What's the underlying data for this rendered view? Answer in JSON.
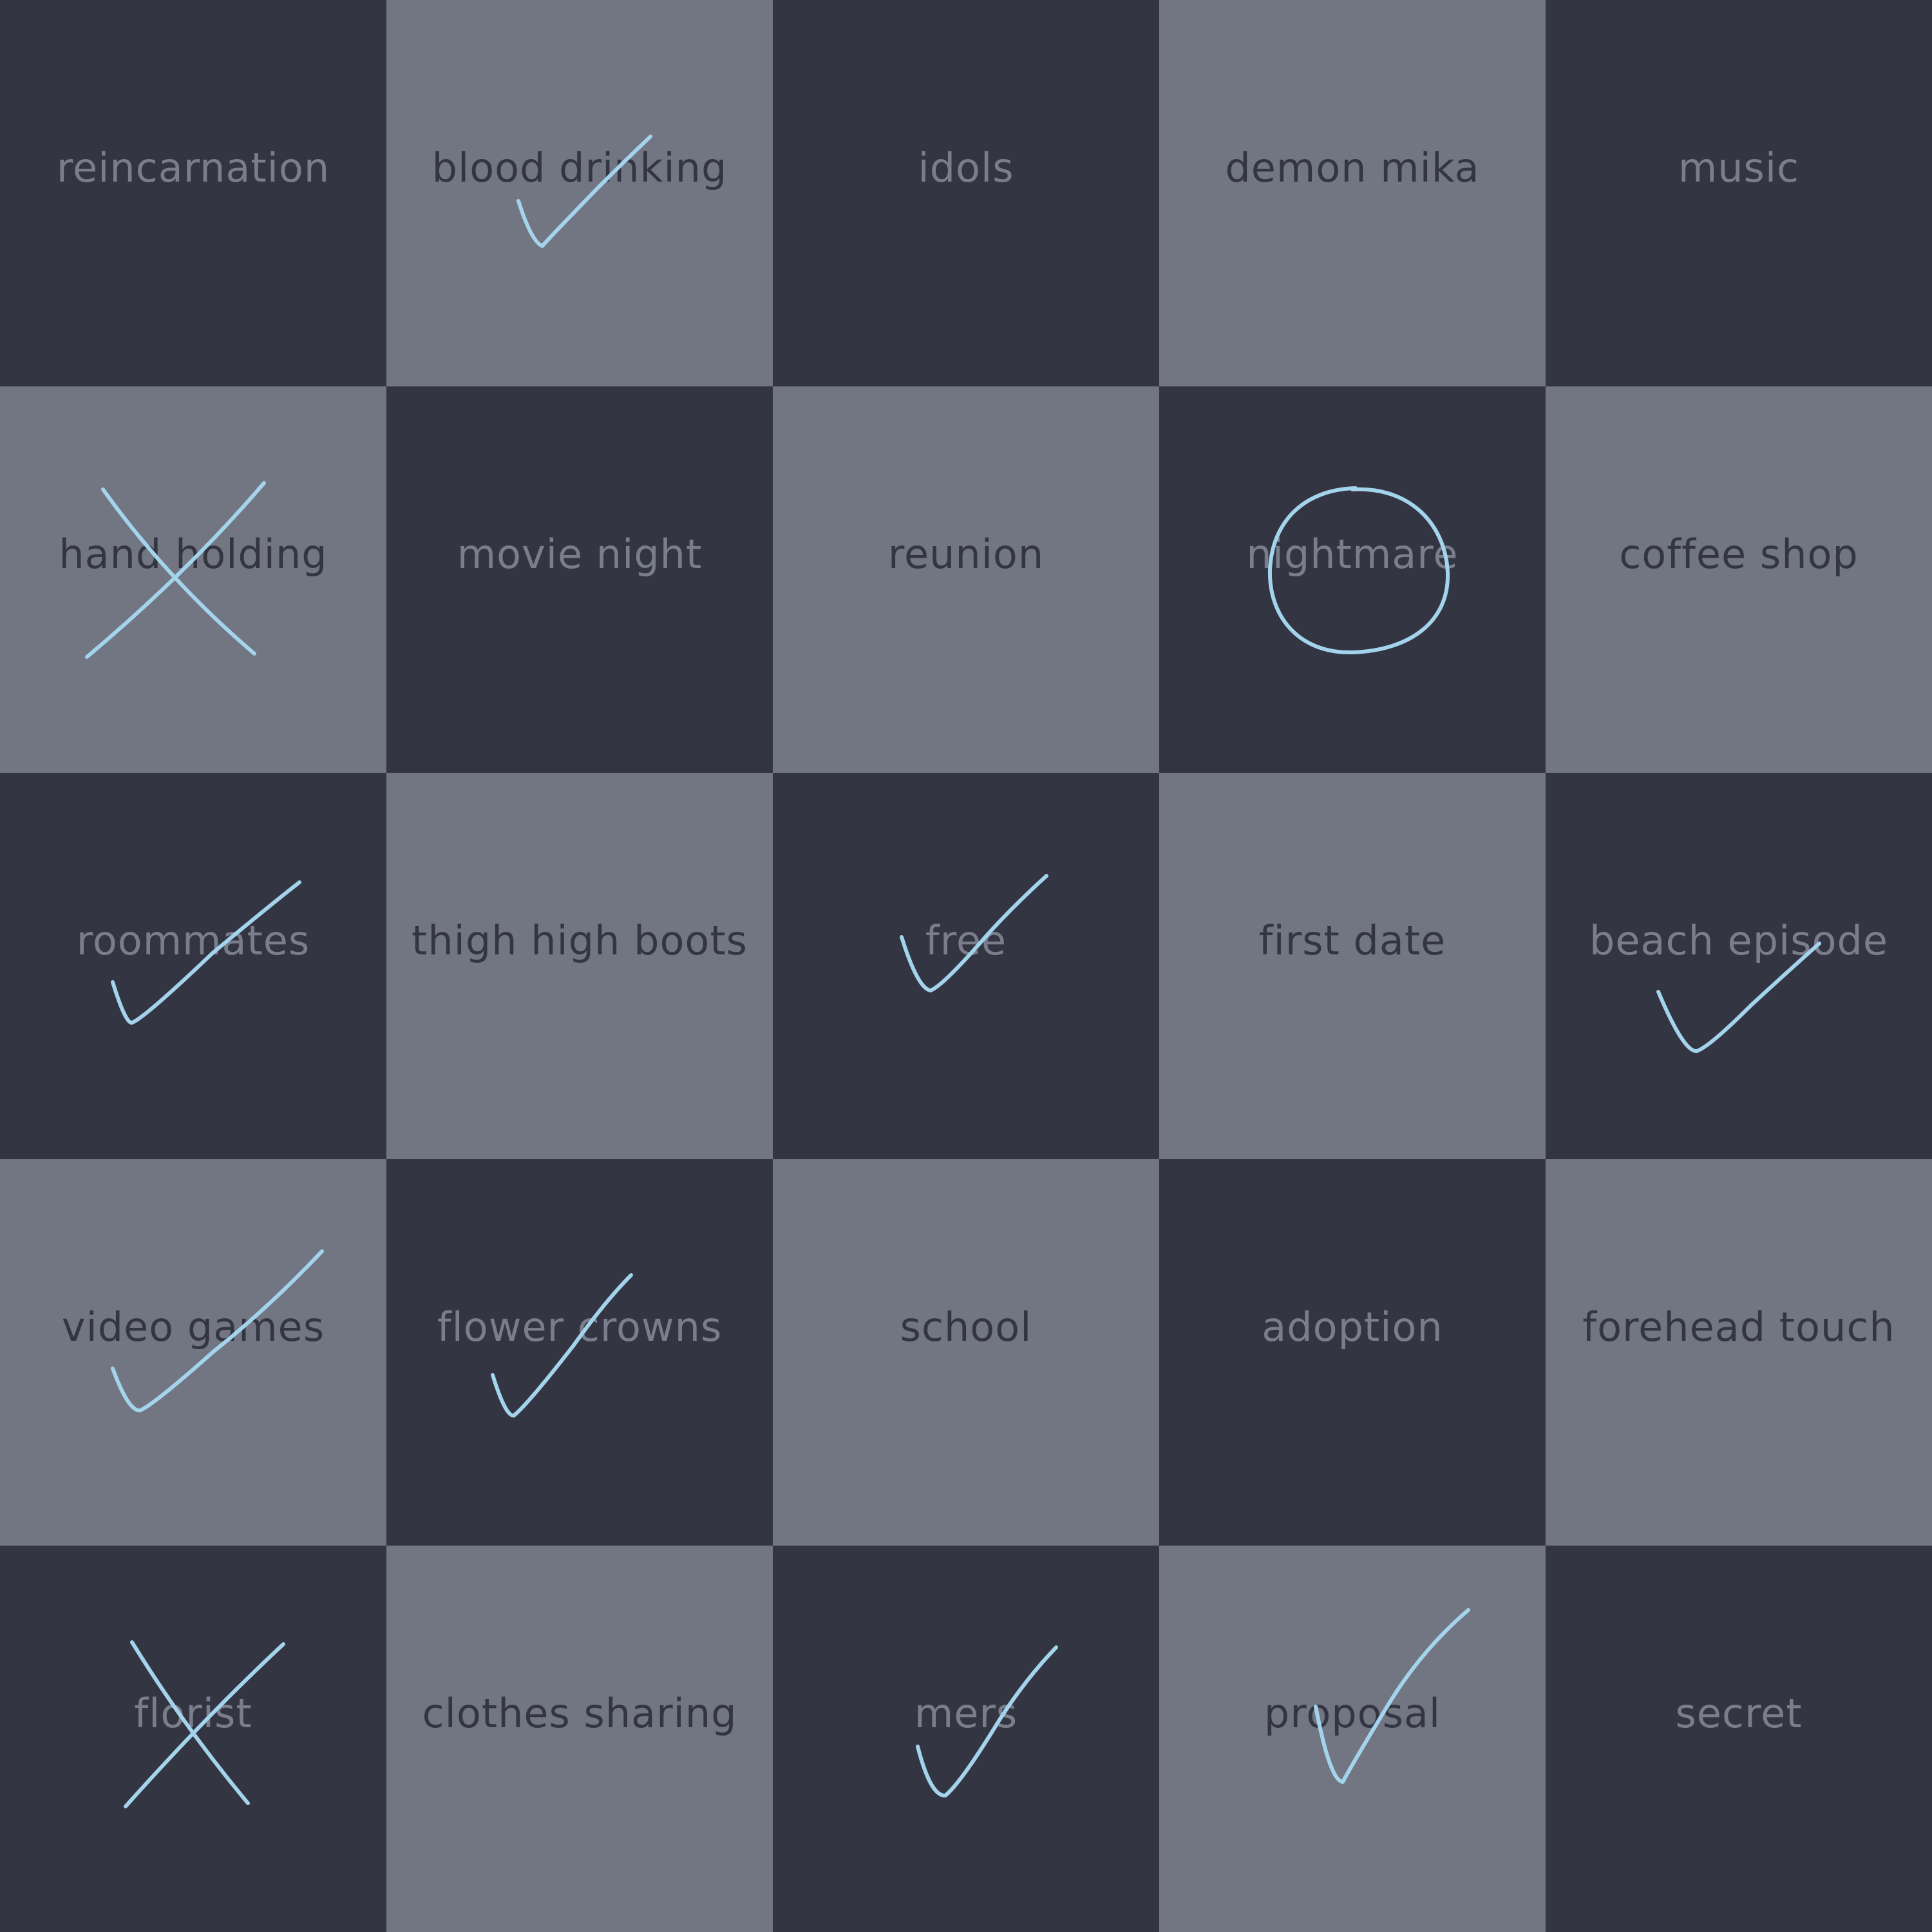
{
  "colors": {
    "dark_cell": "#333542",
    "light_cell": "#727683",
    "mark": "#a3d4ec"
  },
  "board": {
    "rows": 5,
    "cols": 5,
    "cells": [
      {
        "label": "reincarnation",
        "mark": "none"
      },
      {
        "label": "blood drinking",
        "mark": "check"
      },
      {
        "label": "idols",
        "mark": "none"
      },
      {
        "label": "demon mika",
        "mark": "none"
      },
      {
        "label": "music",
        "mark": "none"
      },
      {
        "label": "hand holding",
        "mark": "cross"
      },
      {
        "label": "movie night",
        "mark": "none"
      },
      {
        "label": "reunion",
        "mark": "none"
      },
      {
        "label": "nightmare",
        "mark": "circle"
      },
      {
        "label": "coffee shop",
        "mark": "none"
      },
      {
        "label": "roommates",
        "mark": "check"
      },
      {
        "label": "thigh high boots",
        "mark": "none"
      },
      {
        "label": "free",
        "mark": "check"
      },
      {
        "label": "first date",
        "mark": "none"
      },
      {
        "label": "beach episode",
        "mark": "check"
      },
      {
        "label": "video games",
        "mark": "check"
      },
      {
        "label": "flower crowns",
        "mark": "check"
      },
      {
        "label": "school",
        "mark": "none"
      },
      {
        "label": "adoption",
        "mark": "none"
      },
      {
        "label": "forehead touch",
        "mark": "none"
      },
      {
        "label": "florist",
        "mark": "cross"
      },
      {
        "label": "clothes sharing",
        "mark": "none"
      },
      {
        "label": "mers",
        "mark": "check"
      },
      {
        "label": "proposal",
        "mark": "check"
      },
      {
        "label": "secret",
        "mark": "none"
      }
    ]
  }
}
